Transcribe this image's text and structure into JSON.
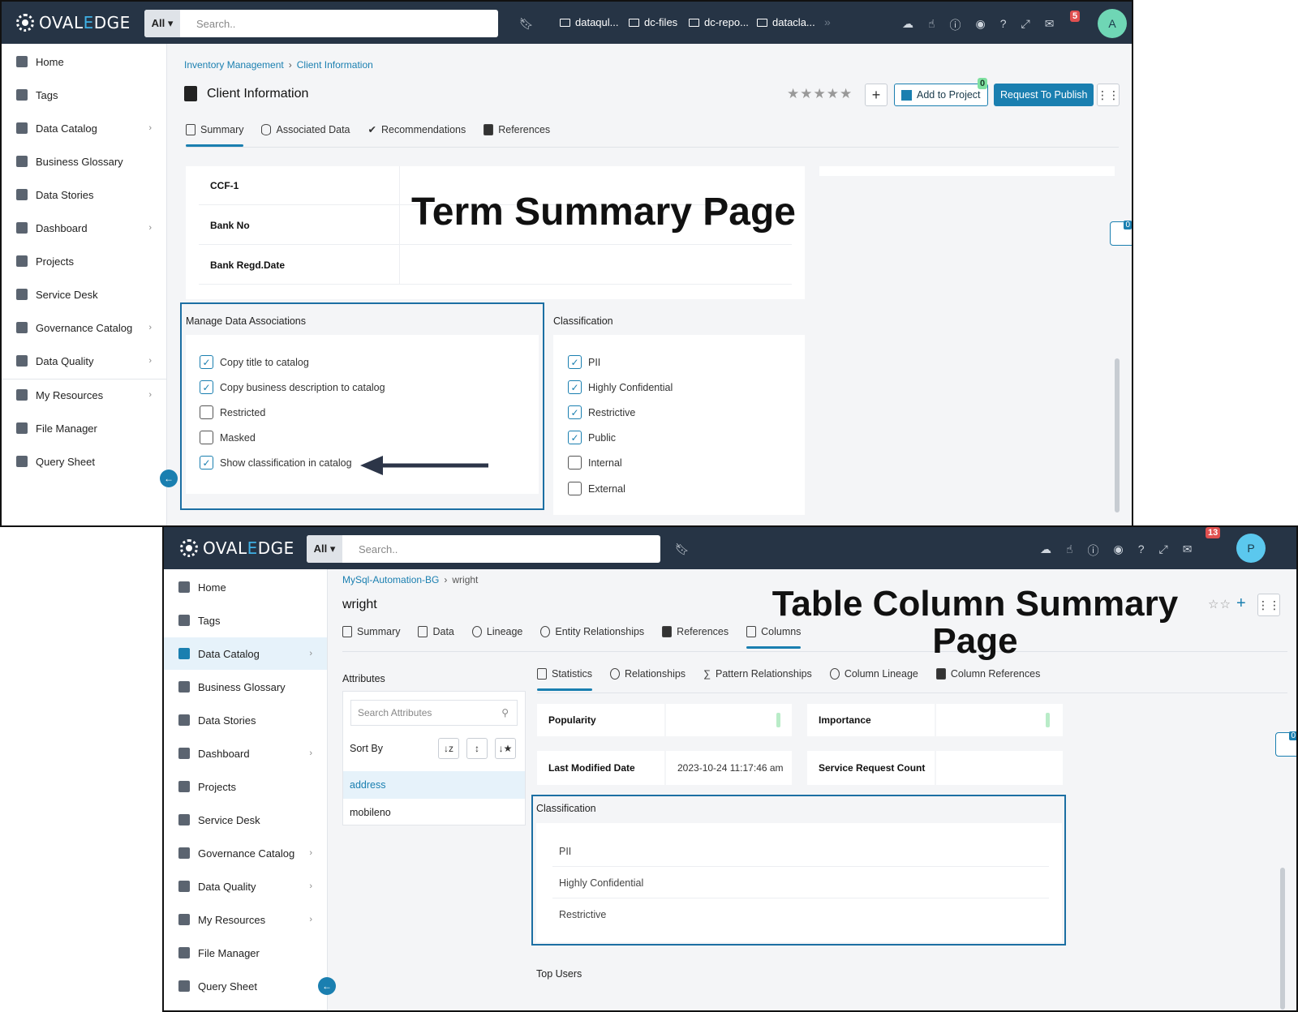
{
  "annotations": {
    "term_page": "Term Summary Page",
    "column_page_line1": "Table Column Summary",
    "column_page_line2": "Page"
  },
  "w1": {
    "logo": {
      "a": "OVAL",
      "b": "E",
      "c": "DGE"
    },
    "search": {
      "scope": "All ▾",
      "placeholder": "Search.."
    },
    "folders": [
      "dataqul...",
      "dc-files",
      "dc-repo...",
      "datacla..."
    ],
    "more": "»",
    "notifications": "5",
    "avatar": "A",
    "sidebar": [
      "Home",
      "Tags",
      "Data Catalog",
      "Business Glossary",
      "Data Stories",
      "Dashboard",
      "Projects",
      "Service Desk",
      "Governance Catalog",
      "Data Quality",
      "My Resources",
      "File Manager",
      "Query Sheet"
    ],
    "breadcrumb": {
      "parent": "Inventory Management",
      "current": "Client Information"
    },
    "title": "Client Information",
    "tabs": [
      "Summary",
      "Associated Data",
      "Recommendations",
      "References"
    ],
    "stars": "★★★★★",
    "add_to_project": "Add to Project",
    "project_count": "0",
    "publish": "Request To Publish",
    "chat_count": "0",
    "rows": [
      "CCF-1",
      "Bank No",
      "Bank Regd.Date"
    ],
    "manage": {
      "title": "Manage Data Associations",
      "options": [
        {
          "label": "Copy title to catalog",
          "checked": true
        },
        {
          "label": "Copy business description to catalog",
          "checked": true
        },
        {
          "label": "Restricted",
          "checked": false
        },
        {
          "label": "Masked",
          "checked": false
        },
        {
          "label": "Show classification in catalog",
          "checked": true
        }
      ]
    },
    "classification": {
      "title": "Classification",
      "options": [
        {
          "label": "PII",
          "checked": true
        },
        {
          "label": "Highly Confidential",
          "checked": true
        },
        {
          "label": "Restrictive",
          "checked": true
        },
        {
          "label": "Public",
          "checked": true
        },
        {
          "label": "Internal",
          "checked": false
        },
        {
          "label": "External",
          "checked": false
        }
      ]
    }
  },
  "w2": {
    "logo": {
      "a": "OVAL",
      "b": "E",
      "c": "DGE"
    },
    "search": {
      "scope": "All ▾",
      "placeholder": "Search.."
    },
    "notifications": "13",
    "avatar": "P",
    "sidebar": [
      "Home",
      "Tags",
      "Data Catalog",
      "Business Glossary",
      "Data Stories",
      "Dashboard",
      "Projects",
      "Service Desk",
      "Governance Catalog",
      "Data Quality",
      "My Resources",
      "File Manager",
      "Query Sheet"
    ],
    "breadcrumb": {
      "parent": "MySql-Automation-BG",
      "current": "wright"
    },
    "title": "wright",
    "tabs": [
      "Summary",
      "Data",
      "Lineage",
      "Entity Relationships",
      "References",
      "Columns"
    ],
    "subtabs": [
      "Statistics",
      "Relationships",
      "Pattern Relationships",
      "Column Lineage",
      "Column References"
    ],
    "attributes": {
      "title": "Attributes",
      "search_placeholder": "Search Attributes",
      "sort_by": "Sort By",
      "items": [
        "address",
        "mobileno"
      ]
    },
    "stats": {
      "popularity": "Popularity",
      "importance": "Importance",
      "last_modified_label": "Last Modified Date",
      "last_modified_value": "2023-10-24 11:17:46 am",
      "service_request": "Service Request Count"
    },
    "classification": {
      "title": "Classification",
      "items": [
        "PII",
        "Highly Confidential",
        "Restrictive"
      ]
    },
    "top_users": "Top Users",
    "chat_count": "0"
  }
}
